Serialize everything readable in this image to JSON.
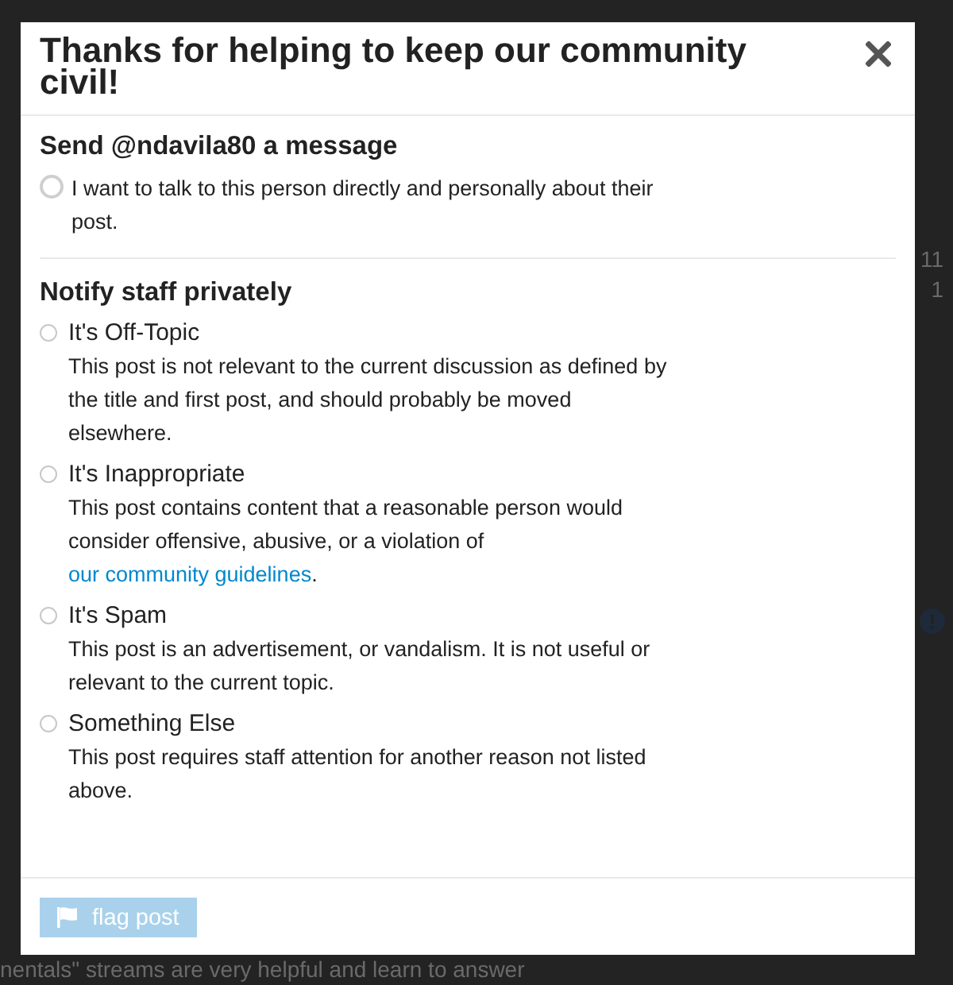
{
  "background": {
    "counts": [
      "11",
      "1"
    ],
    "footer_text": "nentals\" streams are very helpful and learn to answer"
  },
  "modal": {
    "title": "Thanks for helping to keep our community civil!",
    "sections": [
      {
        "heading": "Send @ndavila80 a message",
        "options": [
          {
            "kind": "plain",
            "description": "I want to talk to this person directly and personally about their post.",
            "selected": false
          }
        ]
      },
      {
        "heading": "Notify staff privately",
        "options": [
          {
            "kind": "titled",
            "label": "It's Off-Topic",
            "description": "This post is not relevant to the current discussion as defined by the title and first post, and should probably be moved elsewhere.",
            "selected": false
          },
          {
            "kind": "titled",
            "label": "It's Inappropriate",
            "description": "This post contains content that a reasonable person would consider offensive, abusive, or a violation of ",
            "link": "our community guidelines",
            "description_end": ".",
            "selected": false
          },
          {
            "kind": "titled",
            "label": "It's Spam",
            "description": "This post is an advertisement, or vandalism. It is not useful or relevant to the current topic.",
            "selected": false
          },
          {
            "kind": "titled",
            "label": "Something Else",
            "description": "This post requires staff attention for another reason not listed above.",
            "selected": false
          }
        ]
      }
    ],
    "button": {
      "label": "flag post",
      "disabled": true
    }
  }
}
